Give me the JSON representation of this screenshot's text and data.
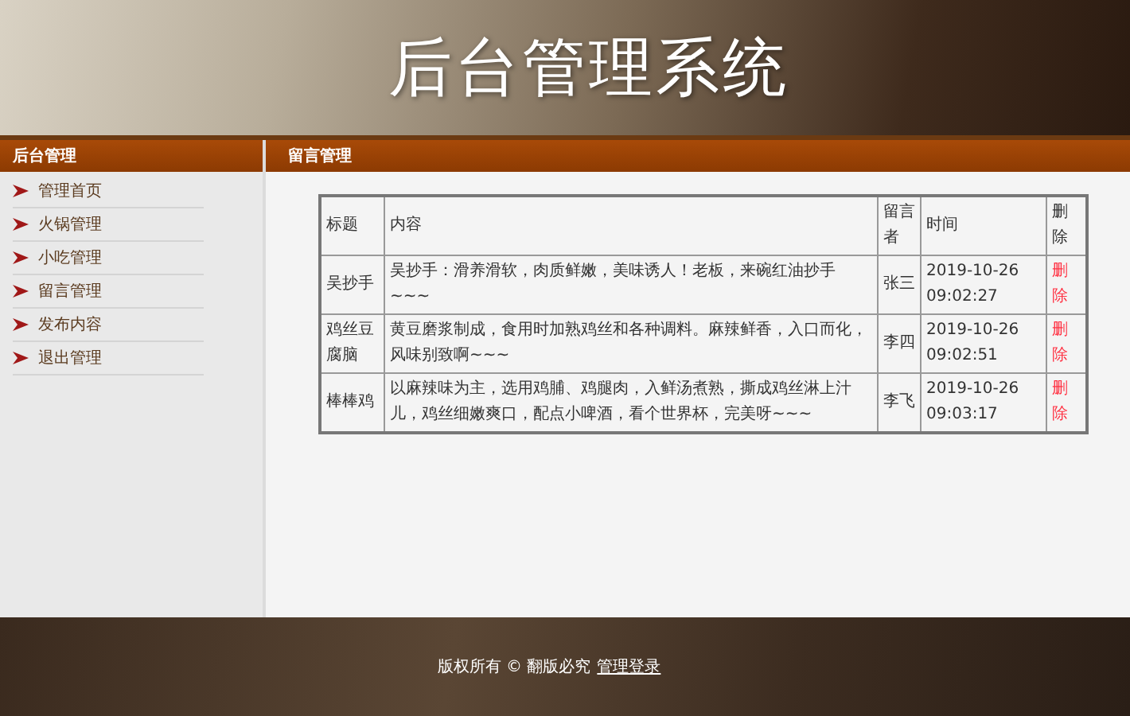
{
  "header": {
    "title": "后台管理系统"
  },
  "sidebar": {
    "title": "后台管理",
    "items": [
      {
        "label": "管理首页"
      },
      {
        "label": "火锅管理"
      },
      {
        "label": "小吃管理"
      },
      {
        "label": "留言管理"
      },
      {
        "label": "发布内容"
      },
      {
        "label": "退出管理"
      }
    ]
  },
  "main": {
    "title": "留言管理",
    "table": {
      "columns": [
        "标题",
        "内容",
        "留言者",
        "时间",
        "删除"
      ],
      "rows": [
        {
          "title": "吴抄手",
          "content": "吴抄手：滑养滑软，肉质鲜嫩，美味诱人！老板，来碗红油抄手~~~",
          "author": "张三",
          "time": "2019-10-26 09:02:27",
          "action": "删除"
        },
        {
          "title": "鸡丝豆腐脑",
          "content": "黄豆磨浆制成，食用时加熟鸡丝和各种调料。麻辣鲜香，入口而化，风味别致啊~~~",
          "author": "李四",
          "time": "2019-10-26 09:02:51",
          "action": "删除"
        },
        {
          "title": "棒棒鸡",
          "content": "以麻辣味为主，选用鸡脯、鸡腿肉，入鲜汤煮熟，撕成鸡丝淋上汁儿，鸡丝细嫩爽口，配点小啤酒，看个世界杯，完美呀~~~",
          "author": "李飞",
          "time": "2019-10-26 09:03:17",
          "action": "删除"
        }
      ]
    }
  },
  "footer": {
    "copyright": "版权所有 © 翻版必究",
    "link": "管理登录"
  }
}
